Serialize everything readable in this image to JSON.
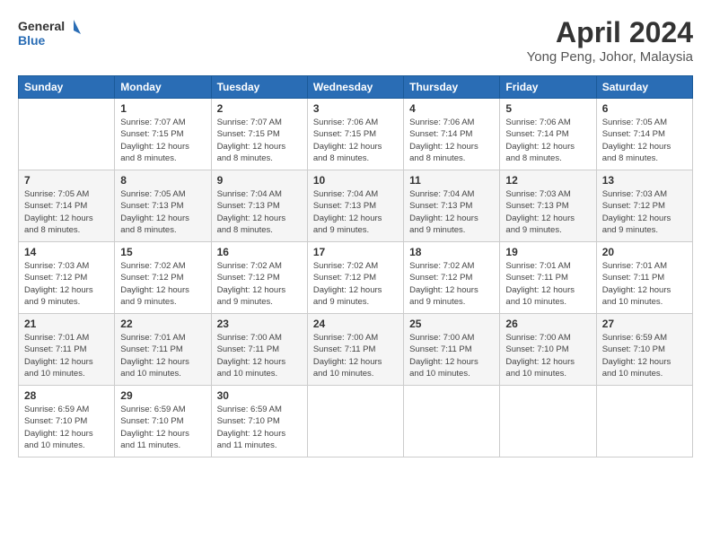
{
  "header": {
    "logo_line1": "General",
    "logo_line2": "Blue",
    "title": "April 2024",
    "location": "Yong Peng, Johor, Malaysia"
  },
  "days_of_week": [
    "Sunday",
    "Monday",
    "Tuesday",
    "Wednesday",
    "Thursday",
    "Friday",
    "Saturday"
  ],
  "weeks": [
    [
      {
        "day": "",
        "text": ""
      },
      {
        "day": "1",
        "text": "Sunrise: 7:07 AM\nSunset: 7:15 PM\nDaylight: 12 hours\nand 8 minutes."
      },
      {
        "day": "2",
        "text": "Sunrise: 7:07 AM\nSunset: 7:15 PM\nDaylight: 12 hours\nand 8 minutes."
      },
      {
        "day": "3",
        "text": "Sunrise: 7:06 AM\nSunset: 7:15 PM\nDaylight: 12 hours\nand 8 minutes."
      },
      {
        "day": "4",
        "text": "Sunrise: 7:06 AM\nSunset: 7:14 PM\nDaylight: 12 hours\nand 8 minutes."
      },
      {
        "day": "5",
        "text": "Sunrise: 7:06 AM\nSunset: 7:14 PM\nDaylight: 12 hours\nand 8 minutes."
      },
      {
        "day": "6",
        "text": "Sunrise: 7:05 AM\nSunset: 7:14 PM\nDaylight: 12 hours\nand 8 minutes."
      }
    ],
    [
      {
        "day": "7",
        "text": "Sunrise: 7:05 AM\nSunset: 7:14 PM\nDaylight: 12 hours\nand 8 minutes."
      },
      {
        "day": "8",
        "text": "Sunrise: 7:05 AM\nSunset: 7:13 PM\nDaylight: 12 hours\nand 8 minutes."
      },
      {
        "day": "9",
        "text": "Sunrise: 7:04 AM\nSunset: 7:13 PM\nDaylight: 12 hours\nand 8 minutes."
      },
      {
        "day": "10",
        "text": "Sunrise: 7:04 AM\nSunset: 7:13 PM\nDaylight: 12 hours\nand 9 minutes."
      },
      {
        "day": "11",
        "text": "Sunrise: 7:04 AM\nSunset: 7:13 PM\nDaylight: 12 hours\nand 9 minutes."
      },
      {
        "day": "12",
        "text": "Sunrise: 7:03 AM\nSunset: 7:13 PM\nDaylight: 12 hours\nand 9 minutes."
      },
      {
        "day": "13",
        "text": "Sunrise: 7:03 AM\nSunset: 7:12 PM\nDaylight: 12 hours\nand 9 minutes."
      }
    ],
    [
      {
        "day": "14",
        "text": "Sunrise: 7:03 AM\nSunset: 7:12 PM\nDaylight: 12 hours\nand 9 minutes."
      },
      {
        "day": "15",
        "text": "Sunrise: 7:02 AM\nSunset: 7:12 PM\nDaylight: 12 hours\nand 9 minutes."
      },
      {
        "day": "16",
        "text": "Sunrise: 7:02 AM\nSunset: 7:12 PM\nDaylight: 12 hours\nand 9 minutes."
      },
      {
        "day": "17",
        "text": "Sunrise: 7:02 AM\nSunset: 7:12 PM\nDaylight: 12 hours\nand 9 minutes."
      },
      {
        "day": "18",
        "text": "Sunrise: 7:02 AM\nSunset: 7:12 PM\nDaylight: 12 hours\nand 9 minutes."
      },
      {
        "day": "19",
        "text": "Sunrise: 7:01 AM\nSunset: 7:11 PM\nDaylight: 12 hours\nand 10 minutes."
      },
      {
        "day": "20",
        "text": "Sunrise: 7:01 AM\nSunset: 7:11 PM\nDaylight: 12 hours\nand 10 minutes."
      }
    ],
    [
      {
        "day": "21",
        "text": "Sunrise: 7:01 AM\nSunset: 7:11 PM\nDaylight: 12 hours\nand 10 minutes."
      },
      {
        "day": "22",
        "text": "Sunrise: 7:01 AM\nSunset: 7:11 PM\nDaylight: 12 hours\nand 10 minutes."
      },
      {
        "day": "23",
        "text": "Sunrise: 7:00 AM\nSunset: 7:11 PM\nDaylight: 12 hours\nand 10 minutes."
      },
      {
        "day": "24",
        "text": "Sunrise: 7:00 AM\nSunset: 7:11 PM\nDaylight: 12 hours\nand 10 minutes."
      },
      {
        "day": "25",
        "text": "Sunrise: 7:00 AM\nSunset: 7:11 PM\nDaylight: 12 hours\nand 10 minutes."
      },
      {
        "day": "26",
        "text": "Sunrise: 7:00 AM\nSunset: 7:10 PM\nDaylight: 12 hours\nand 10 minutes."
      },
      {
        "day": "27",
        "text": "Sunrise: 6:59 AM\nSunset: 7:10 PM\nDaylight: 12 hours\nand 10 minutes."
      }
    ],
    [
      {
        "day": "28",
        "text": "Sunrise: 6:59 AM\nSunset: 7:10 PM\nDaylight: 12 hours\nand 10 minutes."
      },
      {
        "day": "29",
        "text": "Sunrise: 6:59 AM\nSunset: 7:10 PM\nDaylight: 12 hours\nand 11 minutes."
      },
      {
        "day": "30",
        "text": "Sunrise: 6:59 AM\nSunset: 7:10 PM\nDaylight: 12 hours\nand 11 minutes."
      },
      {
        "day": "",
        "text": ""
      },
      {
        "day": "",
        "text": ""
      },
      {
        "day": "",
        "text": ""
      },
      {
        "day": "",
        "text": ""
      }
    ]
  ]
}
